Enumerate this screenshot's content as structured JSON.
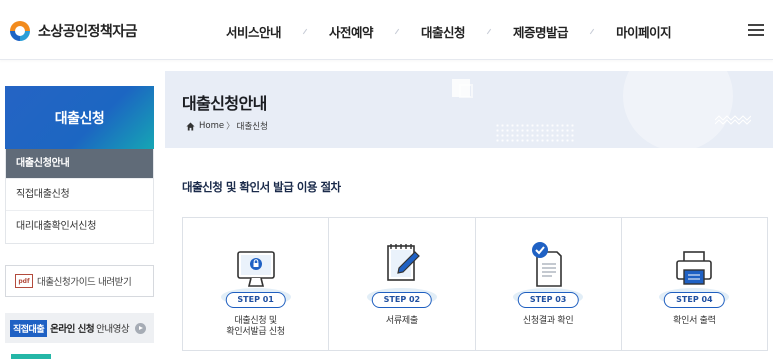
{
  "header": {
    "logo_text": "소상공인정책자금",
    "nav": [
      "서비스안내",
      "사전예약",
      "대출신청",
      "제증명발급",
      "마이페이지"
    ]
  },
  "sidebar": {
    "title": "대출신청",
    "items": [
      {
        "label": "대출신청안내",
        "active": true
      },
      {
        "label": "직접대출신청",
        "active": false
      },
      {
        "label": "대리대출확인서신청",
        "active": false
      }
    ],
    "guide_label": "대출신청가이드 내려받기",
    "pdf_tag": "pdf",
    "video": {
      "tag": "직접대출",
      "bold": "온라인 신청",
      "rest": "안내영상"
    }
  },
  "banner": {
    "title": "대출신청안내",
    "breadcrumb": {
      "home": "Home",
      "separator": "〉",
      "current": "대출신청"
    }
  },
  "section": {
    "title": "대출신청 및 확인서 발급 이용 절차",
    "steps": [
      {
        "badge": "STEP 01",
        "label_line1": "대출신청 및",
        "label_line2": "확인서발급 신청",
        "icon": "monitor-lock-icon"
      },
      {
        "badge": "STEP 02",
        "label_line1": "서류제출",
        "label_line2": "",
        "icon": "document-pen-icon"
      },
      {
        "badge": "STEP 03",
        "label_line1": "신청결과 확인",
        "label_line2": "",
        "icon": "document-check-icon"
      },
      {
        "badge": "STEP 04",
        "label_line1": "확인서 출력",
        "label_line2": "",
        "icon": "printer-icon"
      }
    ]
  },
  "colors": {
    "brand_blue": "#1f5fc0",
    "teal": "#25b7a7",
    "active_gray": "#606b78"
  }
}
